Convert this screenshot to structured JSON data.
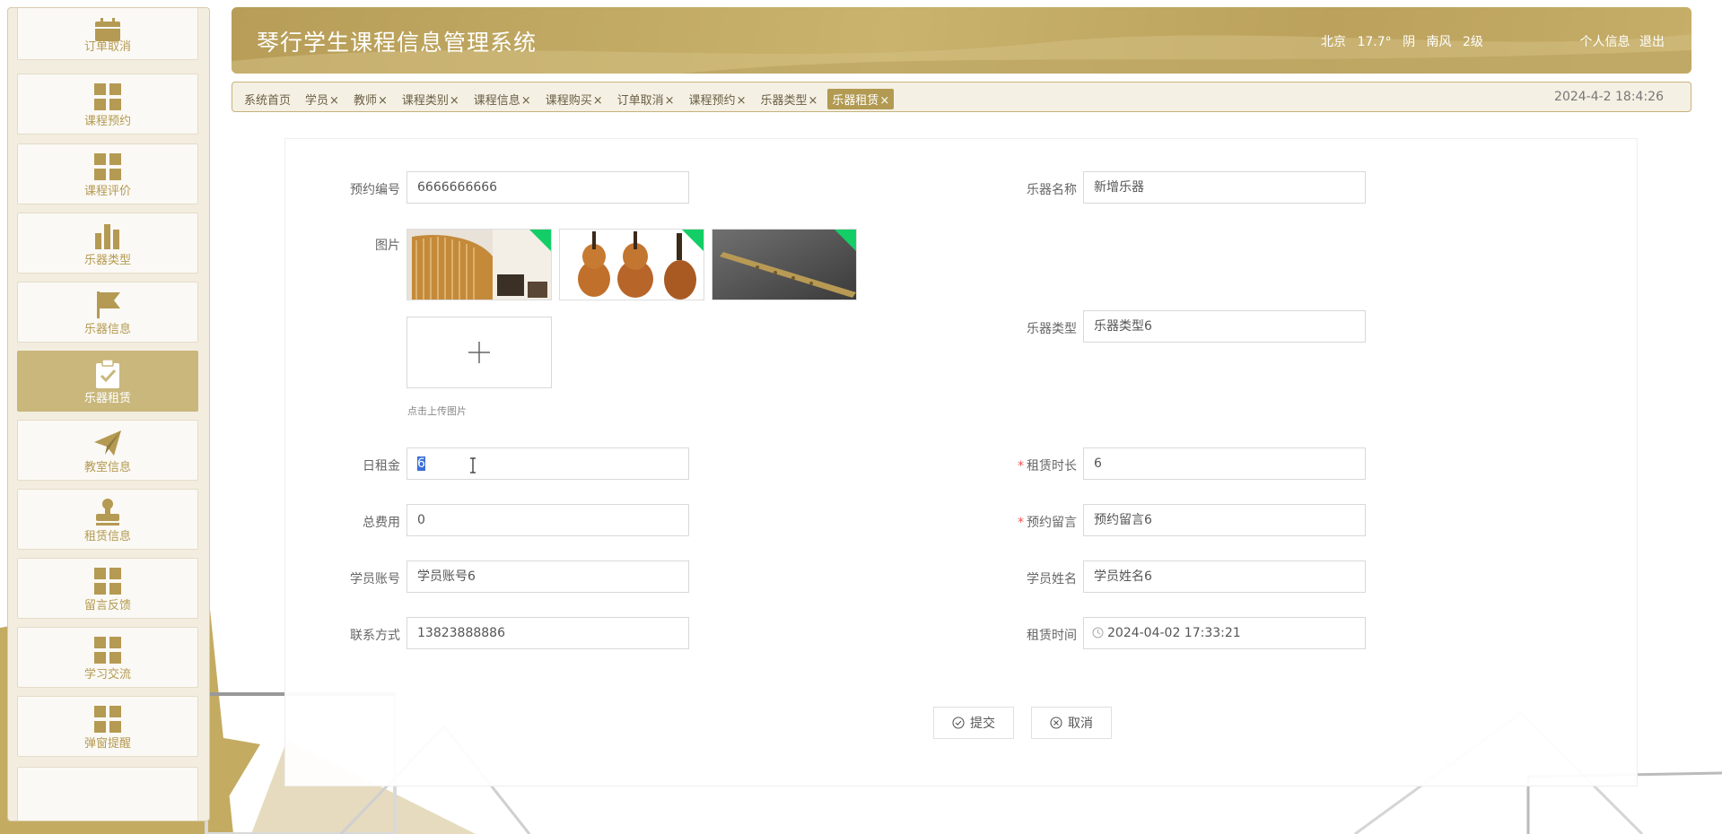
{
  "colors": {
    "accent": "#b79d57",
    "active_tab": "#b29a52",
    "sidebar_active": "#c9b77c",
    "required": "#e55555",
    "uploaded_badge": "#13ce66"
  },
  "sidebar": {
    "items": [
      {
        "label": "订单取消",
        "icon": "calendar-icon"
      },
      {
        "label": "课程预约",
        "icon": "grid-icon"
      },
      {
        "label": "课程评价",
        "icon": "grid-icon"
      },
      {
        "label": "乐器类型",
        "icon": "bar-chart-icon"
      },
      {
        "label": "乐器信息",
        "icon": "flag-icon"
      },
      {
        "label": "乐器租赁",
        "icon": "clipboard-check-icon"
      },
      {
        "label": "教室信息",
        "icon": "paper-plane-icon"
      },
      {
        "label": "租赁信息",
        "icon": "stamp-icon"
      },
      {
        "label": "留言反馈",
        "icon": "grid-icon"
      },
      {
        "label": "学习交流",
        "icon": "grid-icon"
      },
      {
        "label": "弹窗提醒",
        "icon": "grid-icon"
      }
    ]
  },
  "header": {
    "title": "琴行学生课程信息管理系统",
    "weather": {
      "city": "北京",
      "temp": "17.7°",
      "condition": "阴",
      "wind": "南风",
      "level": "2级"
    },
    "profile_link": "个人信息",
    "logout_link": "退出"
  },
  "tabs": {
    "items": [
      "系统首页",
      "学员",
      "教师",
      "课程类别",
      "课程信息",
      "课程购买",
      "订单取消",
      "课程预约",
      "乐器类型",
      "乐器租赁"
    ],
    "close_mark": "×",
    "datetime": "2024-4-2 18:4:26"
  },
  "form": {
    "reservation_no": {
      "label": "预约编号",
      "value": "6666666666"
    },
    "instrument_name": {
      "label": "乐器名称",
      "value": "新增乐器"
    },
    "image": {
      "label": "图片",
      "upload_hint": "点击上传图片"
    },
    "instrument_type": {
      "label": "乐器类型",
      "value": "乐器类型6"
    },
    "daily_rent": {
      "label": "日租金",
      "value": "6"
    },
    "rent_duration": {
      "label": "租赁时长",
      "value": "6",
      "required": "*"
    },
    "total_cost": {
      "label": "总费用",
      "value": "0"
    },
    "reservation_note": {
      "label": "预约留言",
      "value": "预约留言6",
      "required": "*"
    },
    "student_account": {
      "label": "学员账号",
      "value": "学员账号6"
    },
    "student_name": {
      "label": "学员姓名",
      "value": "学员姓名6"
    },
    "contact": {
      "label": "联系方式",
      "value": "13823888886"
    },
    "rent_time": {
      "label": "租赁时间",
      "value": "2024-04-02 17:33:21"
    },
    "submit_label": "提交",
    "cancel_label": "取消"
  }
}
